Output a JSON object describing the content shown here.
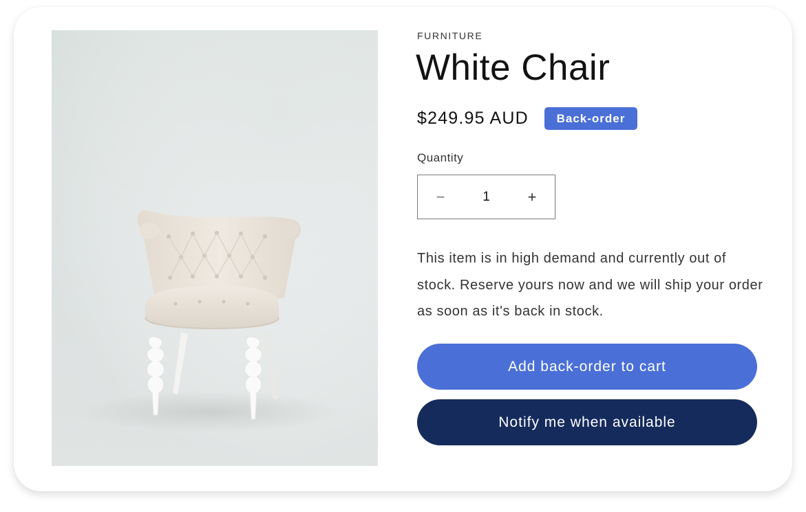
{
  "product": {
    "category": "FURNITURE",
    "title": "White Chair",
    "price": "$249.95 AUD",
    "badge": "Back-order",
    "quantity_label": "Quantity",
    "quantity_value": "1",
    "decrease_symbol": "−",
    "increase_symbol": "+",
    "description": "This item is in high demand and currently out of stock. Reserve yours now and we will ship your order as soon as it's back in stock.",
    "image_subject": "white tufted armchair"
  },
  "actions": {
    "primary_label": "Add back-order to cart",
    "secondary_label": "Notify me when available"
  },
  "colors": {
    "accent": "#4a6fd6",
    "navy": "#152b5c",
    "text": "#121212"
  },
  "icons": {
    "decrease": "minus-icon",
    "increase": "plus-icon"
  }
}
